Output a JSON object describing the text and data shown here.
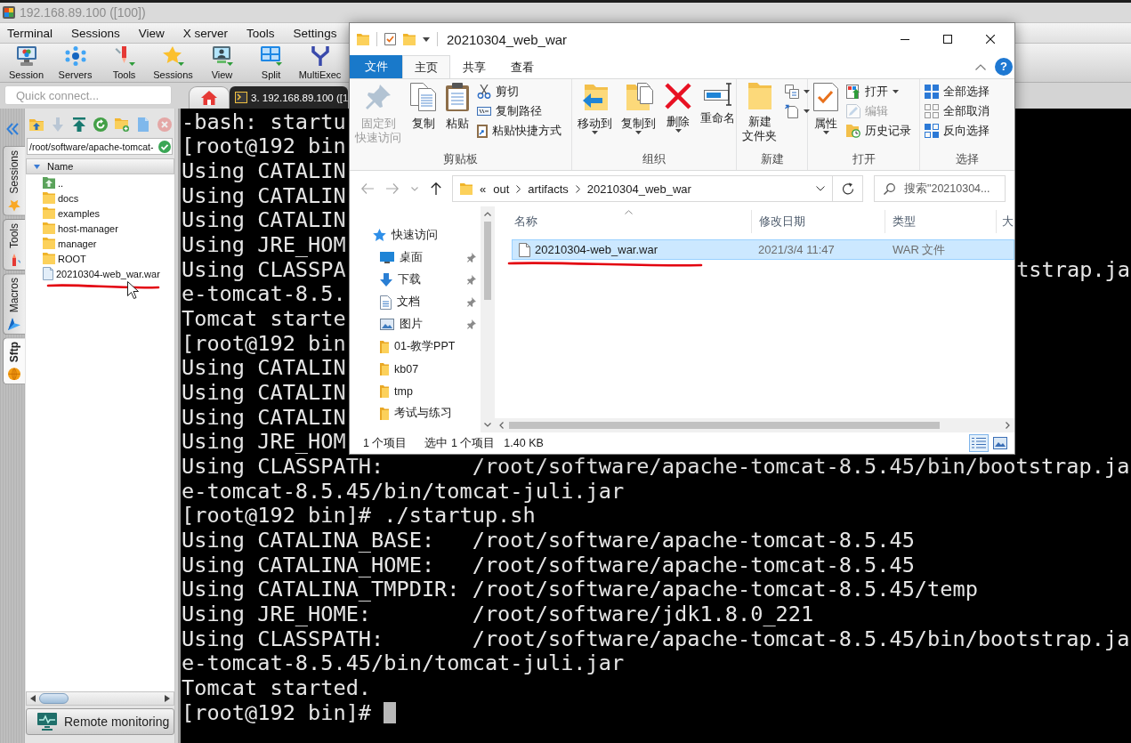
{
  "mobaxterm": {
    "title": "192.168.89.100 ([100])",
    "menu": [
      "Terminal",
      "Sessions",
      "View",
      "X server",
      "Tools",
      "Settings"
    ],
    "toolbar": [
      {
        "label": "Session",
        "kind": "session"
      },
      {
        "label": "Servers",
        "kind": "servers"
      },
      {
        "label": "Tools",
        "kind": "tools"
      },
      {
        "label": "Sessions",
        "kind": "sessions"
      },
      {
        "label": "View",
        "kind": "view"
      },
      {
        "label": "Split",
        "kind": "split"
      },
      {
        "label": "MultiExec",
        "kind": "multiexec"
      }
    ],
    "quick_connect": {
      "placeholder": "Quick connect..."
    },
    "side_tabs": [
      {
        "label": "Sessions",
        "kind": "sessions",
        "selected": false
      },
      {
        "label": "Tools",
        "kind": "tools",
        "selected": false
      },
      {
        "label": "Macros",
        "kind": "macros",
        "selected": false
      },
      {
        "label": "Sftp",
        "kind": "sftp",
        "selected": true
      }
    ],
    "sftp": {
      "toolbar": [
        {
          "kind": "parent",
          "disabled": false
        },
        {
          "kind": "download",
          "disabled": true
        },
        {
          "kind": "upload",
          "disabled": false
        },
        {
          "kind": "refresh",
          "disabled": false
        },
        {
          "kind": "new-folder",
          "disabled": false
        },
        {
          "kind": "new-file",
          "disabled": false
        },
        {
          "kind": "delete",
          "disabled": true
        }
      ],
      "path": "/root/software/apache-tomcat-",
      "column": "Name",
      "items": [
        {
          "name": "..",
          "kind": "parent",
          "marked": false,
          "pointer": false
        },
        {
          "name": "docs",
          "kind": "folder",
          "marked": false,
          "pointer": false
        },
        {
          "name": "examples",
          "kind": "folder",
          "marked": false,
          "pointer": false
        },
        {
          "name": "host-manager",
          "kind": "folder",
          "marked": false,
          "pointer": false
        },
        {
          "name": "manager",
          "kind": "folder",
          "marked": false,
          "pointer": false
        },
        {
          "name": "ROOT",
          "kind": "folder",
          "marked": false,
          "pointer": false
        },
        {
          "name": "20210304-web_war.war",
          "kind": "file",
          "marked": true,
          "pointer": true
        }
      ],
      "remote_monitoring": "Remote monitoring"
    },
    "tabs": [
      {
        "kind": "home",
        "selected": false
      },
      {
        "kind": "session",
        "label": "3. 192.168.89.100 ([1",
        "selected": true
      }
    ],
    "terminal": {
      "lines": [
        {
          "text": "-bash: startu"
        },
        {
          "text": "[root@192 bin"
        },
        {
          "text": "Using CATALIN"
        },
        {
          "text": "Using CATALIN"
        },
        {
          "text": "Using CATALIN"
        },
        {
          "text": "Using JRE_HOM"
        },
        {
          "text": "Using CLASSPA",
          "tail": "tstrap.ja"
        },
        {
          "text": "e-tomcat-8.5."
        },
        {
          "text": "Tomcat starte"
        },
        {
          "text": "[root@192 bin"
        },
        {
          "text": "Using CATALIN"
        },
        {
          "text": "Using CATALIN"
        },
        {
          "text": "Using CATALIN"
        },
        {
          "text": "Using JRE_HOM"
        },
        {
          "text": "Using CLASSPATH:       /root/software/apache-tomcat-8.5.45/bin/bootstrap.ja"
        },
        {
          "text": "e-tomcat-8.5.45/bin/tomcat-juli.jar"
        },
        {
          "text": "[root@192 bin]# ./startup.sh"
        },
        {
          "text": "Using CATALINA_BASE:   /root/software/apache-tomcat-8.5.45"
        },
        {
          "text": "Using CATALINA_HOME:   /root/software/apache-tomcat-8.5.45"
        },
        {
          "text": "Using CATALINA_TMPDIR: /root/software/apache-tomcat-8.5.45/temp"
        },
        {
          "text": "Using JRE_HOME:        /root/software/jdk1.8.0_221"
        },
        {
          "text": "Using CLASSPATH:       /root/software/apache-tomcat-8.5.45/bin/bootstrap.ja"
        },
        {
          "text": "e-tomcat-8.5.45/bin/tomcat-juli.jar"
        },
        {
          "text": "Tomcat started."
        },
        {
          "text": "[root@192 bin]#"
        }
      ],
      "cursor": true
    }
  },
  "explorer": {
    "title": "20210304_web_war",
    "ribbon_tabs": [
      {
        "label": "文件",
        "kind": "menu",
        "selected": false
      },
      {
        "label": "主页",
        "kind": "tab",
        "selected": true
      },
      {
        "label": "共享",
        "kind": "tab",
        "selected": false
      },
      {
        "label": "查看",
        "kind": "tab",
        "selected": false
      }
    ],
    "help": "?",
    "ribbon_groups": [
      {
        "label": "剪贴板",
        "buttons": [
          {
            "lines": [
              "固定到",
              "快速访问"
            ],
            "kind": "pin",
            "disabled": true,
            "dropdown": false
          },
          {
            "lines": [
              "复制"
            ],
            "kind": "copy",
            "disabled": false,
            "dropdown": false
          },
          {
            "lines": [
              "粘贴"
            ],
            "kind": "paste",
            "disabled": false,
            "dropdown": false
          }
        ],
        "small_buttons": [
          {
            "label": "剪切",
            "kind": "cut",
            "disabled": false,
            "dropdown": false
          },
          {
            "label": "复制路径",
            "kind": "copy-path",
            "disabled": false,
            "dropdown": false
          },
          {
            "label": "粘贴快捷方式",
            "kind": "paste-shortcut",
            "disabled": false,
            "dropdown": false
          }
        ]
      },
      {
        "label": "组织",
        "buttons": [
          {
            "lines": [
              "移动到"
            ],
            "kind": "move-to",
            "disabled": false,
            "dropdown": true
          },
          {
            "lines": [
              "复制到"
            ],
            "kind": "copy-to",
            "disabled": false,
            "dropdown": true
          },
          {
            "lines": [
              "删除"
            ],
            "kind": "delete",
            "disabled": false,
            "dropdown": true
          },
          {
            "lines": [
              "重命名"
            ],
            "kind": "rename",
            "disabled": false,
            "dropdown": false
          }
        ]
      },
      {
        "label": "新建",
        "buttons": [
          {
            "lines": [
              "新建",
              "文件夹"
            ],
            "kind": "new-folder",
            "disabled": false,
            "dropdown": false
          }
        ],
        "small_buttons": [
          {
            "kind": "new-item",
            "disabled": false,
            "dropdown": true
          },
          {
            "kind": "easy-access",
            "disabled": false,
            "dropdown": true
          }
        ]
      },
      {
        "label": "打开",
        "buttons": [
          {
            "lines": [
              "属性"
            ],
            "kind": "properties",
            "disabled": false,
            "dropdown": true
          }
        ],
        "small_buttons": [
          {
            "label": "打开",
            "kind": "open",
            "disabled": false,
            "dropdown": true
          },
          {
            "label": "编辑",
            "kind": "edit",
            "disabled": true,
            "dropdown": false
          },
          {
            "label": "历史记录",
            "kind": "history",
            "disabled": false,
            "dropdown": false
          }
        ]
      },
      {
        "label": "选择",
        "small_buttons": [
          {
            "label": "全部选择",
            "kind": "select-all",
            "disabled": false,
            "dropdown": false
          },
          {
            "label": "全部取消",
            "kind": "select-none",
            "disabled": false,
            "dropdown": false
          },
          {
            "label": "反向选择",
            "kind": "invert",
            "disabled": false,
            "dropdown": false
          }
        ]
      }
    ],
    "nav_buttons": [
      {
        "kind": "back",
        "disabled": true
      },
      {
        "kind": "forward",
        "disabled": true
      },
      {
        "kind": "recent",
        "disabled": true
      },
      {
        "kind": "up",
        "disabled": false
      }
    ],
    "address": {
      "overflow": "«",
      "segments": [
        "out",
        "artifacts",
        "20210304_web_war"
      ]
    },
    "search": {
      "placeholder": "搜索\"20210304..."
    },
    "nav_pane": [
      {
        "label": "快速访问",
        "kind": "quick-access",
        "children": [
          {
            "label": "桌面",
            "kind": "desktop",
            "pinned": true
          },
          {
            "label": "下载",
            "kind": "downloads",
            "pinned": true
          },
          {
            "label": "文档",
            "kind": "documents",
            "pinned": true
          },
          {
            "label": "图片",
            "kind": "pictures",
            "pinned": true
          },
          {
            "label": "01-教学PPT",
            "kind": "folder",
            "pinned": false
          },
          {
            "label": "kb07",
            "kind": "folder",
            "pinned": false
          },
          {
            "label": "tmp",
            "kind": "folder",
            "pinned": false
          },
          {
            "label": "考试与练习",
            "kind": "folder",
            "pinned": false
          }
        ]
      }
    ],
    "columns": [
      {
        "label": "名称",
        "sorted": true
      },
      {
        "label": "修改日期",
        "sorted": false
      },
      {
        "label": "类型",
        "sorted": false
      },
      {
        "label": "大",
        "sorted": false
      }
    ],
    "rows": [
      {
        "kind": "file",
        "cells": [
          "20210304-web_war.war",
          "2021/3/4 11:47",
          "WAR 文件"
        ],
        "selected": true,
        "marked": true
      }
    ],
    "status": {
      "count": "1 个项目",
      "selection": "选中 1 个项目",
      "size": "1.40 KB"
    },
    "views": [
      {
        "kind": "details",
        "selected": true
      },
      {
        "kind": "large-icons",
        "selected": false
      }
    ]
  }
}
